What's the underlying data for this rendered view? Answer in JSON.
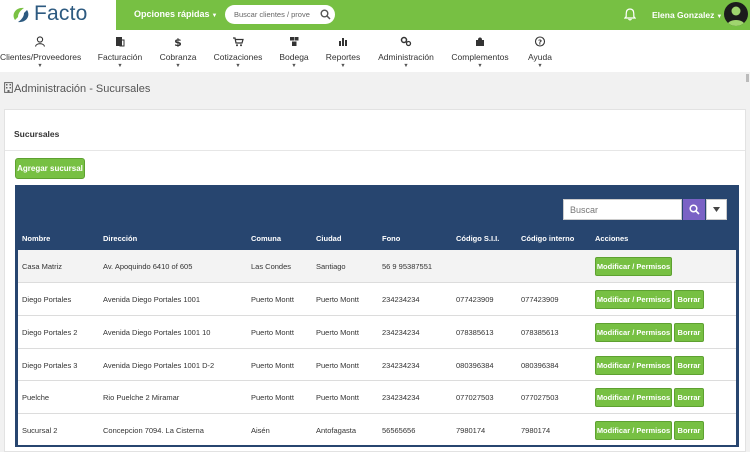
{
  "brand": {
    "name": "Facto",
    "color": "#2d5a80",
    "accent": "#77c043"
  },
  "topbar": {
    "quick_actions": "Opciones rápidas",
    "search_placeholder": "Buscar clientes / prove",
    "user_name": "Elena Gonzalez"
  },
  "nav": [
    {
      "label": "Clientes/Proveedores",
      "icon": "user-group-icon"
    },
    {
      "label": "Facturación",
      "icon": "invoice-icon"
    },
    {
      "label": "Cobranza",
      "icon": "dollar-icon"
    },
    {
      "label": "Cotizaciones",
      "icon": "cart-icon"
    },
    {
      "label": "Bodega",
      "icon": "boxes-icon"
    },
    {
      "label": "Reportes",
      "icon": "bar-chart-icon"
    },
    {
      "label": "Administración",
      "icon": "cogs-icon"
    },
    {
      "label": "Complementos",
      "icon": "puzzle-icon"
    },
    {
      "label": "Ayuda",
      "icon": "help-icon"
    }
  ],
  "page": {
    "title": "Administración - Sucursales"
  },
  "panel": {
    "title": "Sucursales",
    "add_button": "Agregar sucursal",
    "search_placeholder": "Buscar"
  },
  "table": {
    "columns": [
      "Nombre",
      "Dirección",
      "Comuna",
      "Ciudad",
      "Fono",
      "Código S.I.I.",
      "Código interno",
      "Acciones"
    ],
    "modify_label": "Modificar / Permisos",
    "delete_label": "Borrar",
    "rows": [
      {
        "name": "Casa Matriz",
        "address": "Av. Apoquindo 6410 of 605",
        "comuna": "Las Condes",
        "ciudad": "Santiago",
        "fono": "56 9 95387551",
        "sii": "",
        "interno": ""
      },
      {
        "name": "Diego Portales",
        "address": "Avenida Diego Portales 1001",
        "comuna": "Puerto Montt",
        "ciudad": "Puerto Montt",
        "fono": "234234234",
        "sii": "077423909",
        "interno": "077423909"
      },
      {
        "name": "Diego Portales 2",
        "address": "Avenida Diego Portales 1001 10",
        "comuna": "Puerto Montt",
        "ciudad": "Puerto Montt",
        "fono": "234234234",
        "sii": "078385613",
        "interno": "078385613"
      },
      {
        "name": "Diego Portales 3",
        "address": "Avenida Diego Portales 1001 D-2",
        "comuna": "Puerto Montt",
        "ciudad": "Puerto Montt",
        "fono": "234234234",
        "sii": "080396384",
        "interno": "080396384"
      },
      {
        "name": "Puelche",
        "address": "Rio Puelche 2 Miramar",
        "comuna": "Puerto Montt",
        "ciudad": "Puerto Montt",
        "fono": "234234234",
        "sii": "077027503",
        "interno": "077027503"
      },
      {
        "name": "Sucursal 2",
        "address": "Concepcion 7094. La Cisterna",
        "comuna": "Aisén",
        "ciudad": "Antofagasta",
        "fono": "56565656",
        "sii": "7980174",
        "interno": "7980174"
      }
    ]
  }
}
